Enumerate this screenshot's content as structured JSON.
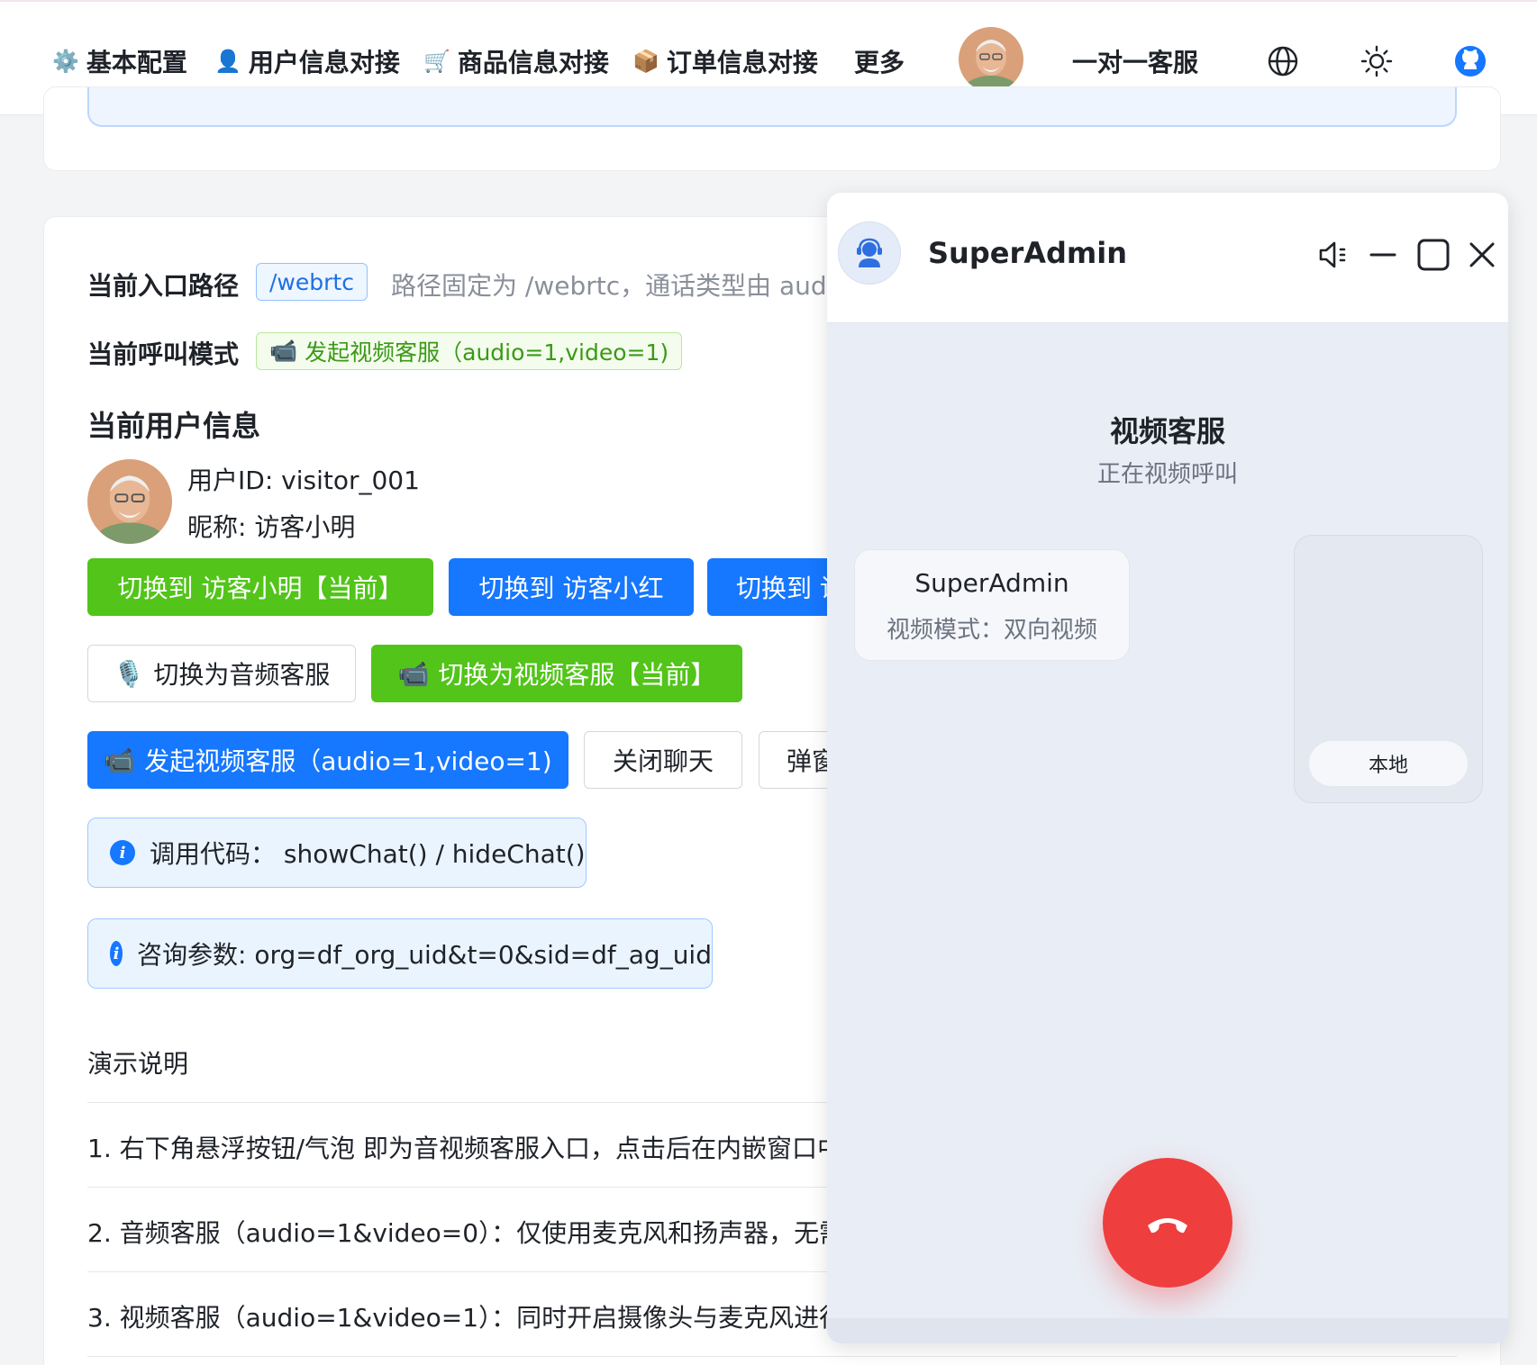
{
  "nav": {
    "items": [
      {
        "emoji": "⚙️",
        "label": "基本配置"
      },
      {
        "emoji": "👤",
        "label": "用户信息对接"
      },
      {
        "emoji": "🛒",
        "label": "商品信息对接"
      },
      {
        "emoji": "📦",
        "label": "订单信息对接"
      }
    ],
    "more_label": "更多",
    "support_label": "一对一客服"
  },
  "main": {
    "entry_path_label": "当前入口路径",
    "entry_path_value": "/webrtc",
    "entry_path_note": "路径固定为 /webrtc，通话类型由 audi",
    "call_mode_label": "当前呼叫模式",
    "call_mode_value": "发起视频客服（audio=1,video=1)",
    "user_info_title": "当前用户信息",
    "user_id_line": "用户ID: visitor_001",
    "nickname_line": "昵称: 访客小明",
    "switch_buttons": [
      "切换到 访客小明【当前】",
      "切换到 访客小红",
      "切换到 访"
    ],
    "audio_mode_button": "切换为音频客服",
    "video_mode_button": "切换为视频客服【当前】",
    "start_video_button": "发起视频客服（audio=1,video=1)",
    "close_chat_button": "关闭聊天",
    "popup_button": "弹窗",
    "code_info": "调用代码：  showChat() / hideChat()",
    "params_info": "咨询参数: org=df_org_uid&t=0&sid=df_ag_uid",
    "demo_title": "演示说明",
    "demo_lines": [
      "1. 右下角悬浮按钮/气泡 即为音视频客服入口，点击后在内嵌窗口中",
      "2. 音频客服（audio=1&video=0）：仅使用麦克风和扬声器，无需",
      "3. 视频客服（audio=1&video=1）：同时开启摄像头与麦克风进行"
    ]
  },
  "chat": {
    "agent_name": "SuperAdmin",
    "call_title": "视频客服",
    "call_status": "正在视频呼叫",
    "remote_name": "SuperAdmin",
    "remote_mode": "视频模式：双向视频",
    "local_label": "本地"
  },
  "colors": {
    "primary": "#1677ff",
    "success": "#52c41a",
    "danger": "#ef3e3e",
    "github": "#1677ff"
  },
  "icons": [
    "gear-icon",
    "user-icon",
    "cart-icon",
    "package-icon",
    "globe-icon",
    "sun-icon",
    "github-icon",
    "speaker-icon",
    "minimize-icon",
    "maximize-icon",
    "close-icon",
    "hangup-icon",
    "mic-icon",
    "video-camera-icon",
    "info-icon"
  ]
}
